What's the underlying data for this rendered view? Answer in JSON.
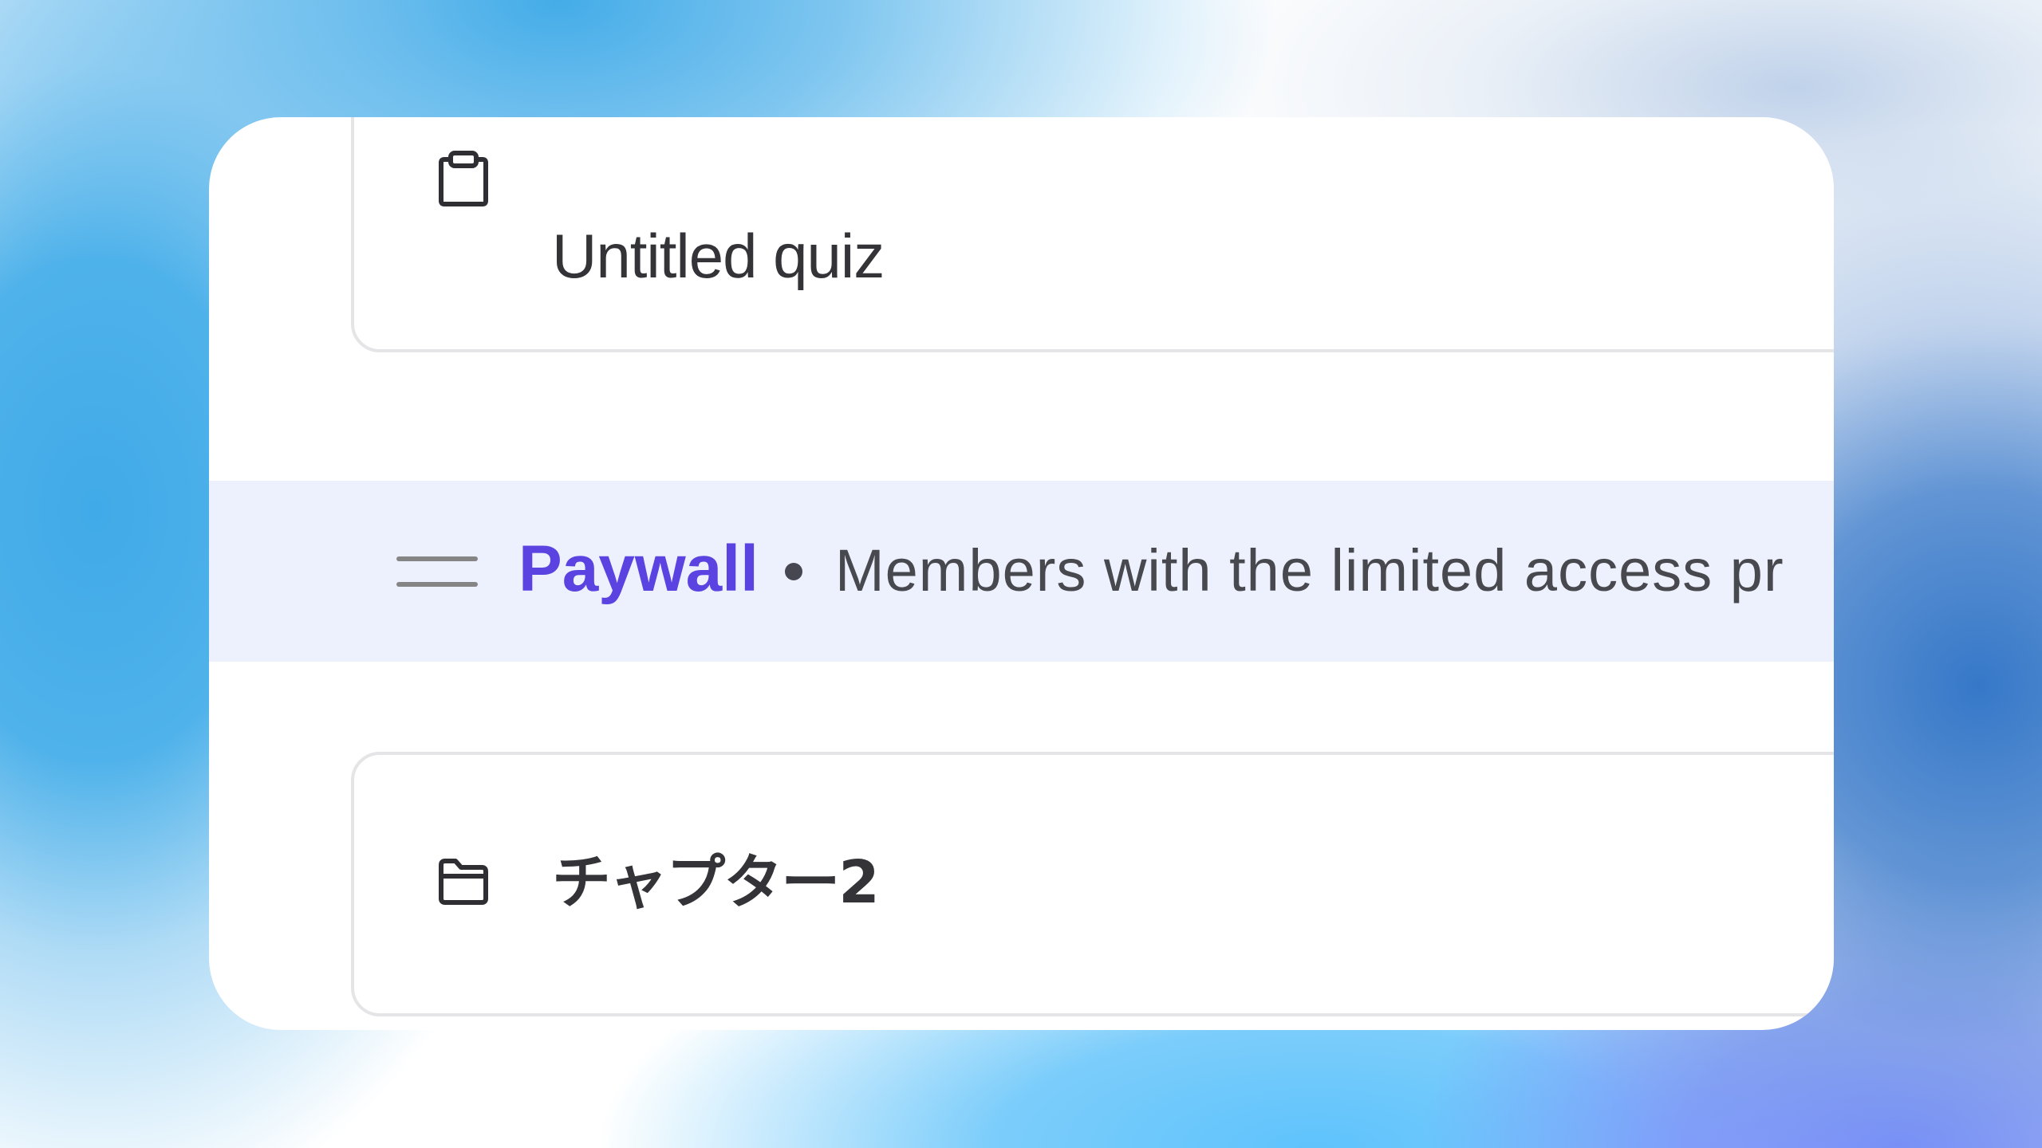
{
  "items": [
    {
      "type": "quiz",
      "icon": "clipboard-icon",
      "title": "Untitled quiz"
    },
    {
      "type": "chapter",
      "icon": "folder-icon",
      "title": "チャプター2"
    }
  ],
  "paywall": {
    "label": "Paywall",
    "separator": "•",
    "description": "Members with the limited access pr",
    "highlight_color": "#5a43e0",
    "row_background": "#edf0fd"
  },
  "colors": {
    "card_background": "#ffffff",
    "item_border": "#e5e5e7",
    "text": "#333338"
  }
}
